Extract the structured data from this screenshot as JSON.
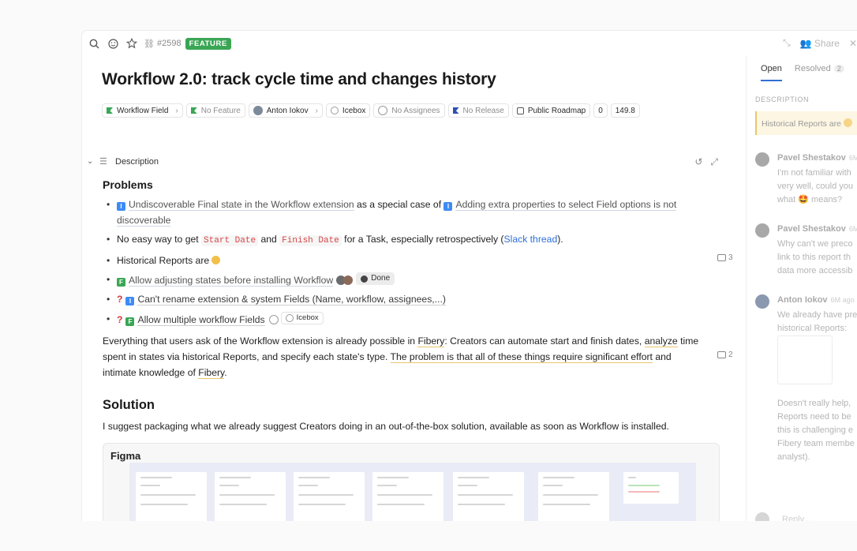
{
  "topbar": {
    "entity_id": "#2598",
    "type_badge": "FEATURE",
    "share_label": "Share"
  },
  "entity": {
    "title": "Workflow 2.0: track cycle time and changes history",
    "fields": {
      "workflow": "Workflow Field",
      "feature": "No Feature",
      "owner": "Anton Iokov",
      "state": "Icebox",
      "assignees": "No Assignees",
      "release": "No Release",
      "roadmap": "Public Roadmap",
      "votes": "0",
      "score": "149.8"
    }
  },
  "description": {
    "header": "Description",
    "problems_heading": "Problems",
    "items": {
      "i1a": "Undiscoverable Final state in the Workflow extension",
      "i1b": " as a special case of ",
      "i1c": "Adding extra properties to select Field options is not discoverable",
      "i2a": "No easy way to get ",
      "i2code1": "Start Date",
      "i2b": " and ",
      "i2code2": "Finish Date",
      "i2c": " for a Task, especially retrospectively (",
      "i2link": "Slack thread",
      "i2d": ").",
      "i3": "Historical Reports are",
      "i4": "Allow adjusting states before installing Workflow",
      "i4status": "Done",
      "i5": "Can't rename extension & system Fields (Name, workflow, assignees,...)",
      "i6": "Allow multiple workflow Fields",
      "i6state": "Icebox",
      "q5": "?",
      "q6": "?"
    },
    "para": {
      "p1": "Everything that users ask of the Workflow extension is already possible in ",
      "p1link": "Fibery",
      "p2": ": Creators can automate start and finish dates, ",
      "p2link": "analyze",
      "p3": " time spent in states via historical Reports, and specify each state's type. ",
      "p3hl": "The problem is that all of these things require significant effort",
      "p4": " and intimate knowledge of ",
      "p4link": "Fibery",
      "p5": "."
    },
    "solution_heading": "Solution",
    "solution_text": "I suggest packaging what we already suggest Creators doing in an out-of-the-box solution, available as soon as Workflow is installed.",
    "embed_title": "Figma",
    "comment_counts": {
      "historical": "3",
      "paragraph": "2"
    }
  },
  "sidebar": {
    "tabs": [
      {
        "label": "Open"
      },
      {
        "label": "Resolved",
        "count": "2"
      }
    ],
    "section_label": "DESCRIPTION",
    "quote": "Historical Reports are",
    "comments": [
      {
        "author": "Pavel Shestakov",
        "time": "6M",
        "lines": [
          "I'm not familiar with",
          "very well, could you",
          "what 🤩 means?"
        ]
      },
      {
        "author": "Pavel Shestakov",
        "time": "6M",
        "lines": [
          "Why can't we preco",
          "link to this report th",
          "data more accessib"
        ]
      },
      {
        "author": "Anton Iokov",
        "time": "6M ago",
        "lines": [
          "We already have pre",
          "historical Reports:"
        ],
        "more": [
          "Doesn't really help,",
          "Reports need to be",
          "this is challenging e",
          "Fibery team membe",
          "analyst)."
        ]
      }
    ],
    "reply_placeholder": "Reply..."
  },
  "colors": {
    "accent": "#2f6fd6",
    "feature_badge": "#3aa655",
    "entity_blue": "#3d8bf5",
    "entity_green": "#3aa655",
    "question": "#d23a3a"
  },
  "icons": [
    "search-icon",
    "emoji-icon",
    "star-icon",
    "link-icon",
    "collapse-icon",
    "share-icon",
    "close-icon",
    "history-icon",
    "expand-icon",
    "comment-icon"
  ]
}
